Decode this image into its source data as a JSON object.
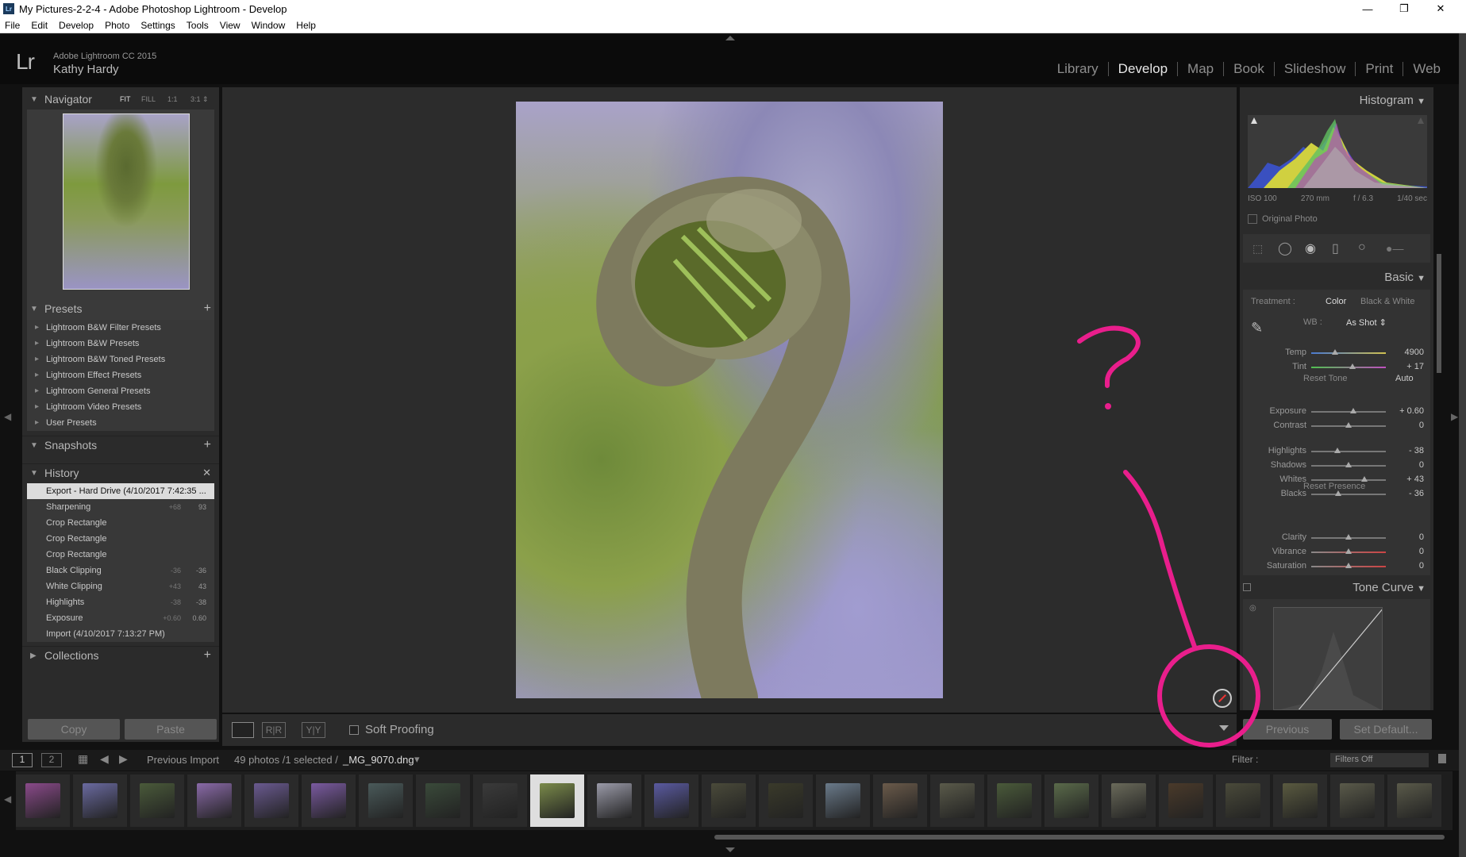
{
  "window": {
    "title": "My Pictures-2-2-4 - Adobe Photoshop Lightroom - Develop",
    "app_icon": "Lr",
    "minimize": "—",
    "maximize": "❐",
    "close": "✕"
  },
  "menu": [
    "File",
    "Edit",
    "Develop",
    "Photo",
    "Settings",
    "Tools",
    "View",
    "Window",
    "Help"
  ],
  "identity": {
    "logo": "Lr",
    "product": "Adobe Lightroom CC 2015",
    "user": "Kathy Hardy"
  },
  "modules": [
    {
      "label": "Library",
      "active": false
    },
    {
      "label": "Develop",
      "active": true
    },
    {
      "label": "Map",
      "active": false
    },
    {
      "label": "Book",
      "active": false
    },
    {
      "label": "Slideshow",
      "active": false
    },
    {
      "label": "Print",
      "active": false
    },
    {
      "label": "Web",
      "active": false
    }
  ],
  "navigator": {
    "title": "Navigator",
    "zoom_options": [
      "FIT",
      "FILL",
      "1:1",
      "3:1 ⇕"
    ]
  },
  "presets": {
    "title": "Presets",
    "add": "+",
    "items": [
      "Lightroom B&W Filter Presets",
      "Lightroom B&W Presets",
      "Lightroom B&W Toned Presets",
      "Lightroom Effect Presets",
      "Lightroom General Presets",
      "Lightroom Video Presets",
      "User Presets"
    ]
  },
  "snapshots": {
    "title": "Snapshots",
    "add": "+"
  },
  "history": {
    "title": "History",
    "clear": "✕",
    "items": [
      {
        "label": "Export - Hard Drive (4/10/2017 7:42:35 ...",
        "v1": "",
        "v2": "",
        "selected": true
      },
      {
        "label": "Sharpening",
        "v1": "+68",
        "v2": "93",
        "selected": false
      },
      {
        "label": "Crop Rectangle",
        "v1": "",
        "v2": "",
        "selected": false
      },
      {
        "label": "Crop Rectangle",
        "v1": "",
        "v2": "",
        "selected": false
      },
      {
        "label": "Crop Rectangle",
        "v1": "",
        "v2": "",
        "selected": false
      },
      {
        "label": "Black Clipping",
        "v1": "-36",
        "v2": "-36",
        "selected": false
      },
      {
        "label": "White Clipping",
        "v1": "+43",
        "v2": "43",
        "selected": false
      },
      {
        "label": "Highlights",
        "v1": "-38",
        "v2": "-38",
        "selected": false
      },
      {
        "label": "Exposure",
        "v1": "+0.60",
        "v2": "0.60",
        "selected": false
      },
      {
        "label": "Import (4/10/2017 7:13:27 PM)",
        "v1": "",
        "v2": "",
        "selected": false
      }
    ]
  },
  "collections": {
    "title": "Collections",
    "add": "+"
  },
  "left_buttons": {
    "copy": "Copy",
    "paste": "Paste"
  },
  "toolbar": {
    "soft_proofing": "Soft Proofing"
  },
  "histogram": {
    "title": "Histogram",
    "iso": "ISO 100",
    "focal": "270 mm",
    "aperture": "f / 6.3",
    "shutter": "1/40 sec",
    "original_photo": "Original Photo"
  },
  "basic": {
    "title": "Basic",
    "treatment_label": "Treatment :",
    "treatment_color": "Color",
    "treatment_bw": "Black & White",
    "wb_label": "WB :",
    "wb_value": "As Shot ⇕",
    "reset_tone": "Reset Tone",
    "auto": "Auto",
    "reset_presence": "Reset Presence",
    "sliders": [
      {
        "label": "Temp",
        "value": "4900",
        "pos": 0.32
      },
      {
        "label": "Tint",
        "value": "+ 17",
        "pos": 0.55
      },
      {
        "label": "Exposure",
        "value": "+ 0.60",
        "pos": 0.56
      },
      {
        "label": "Contrast",
        "value": "0",
        "pos": 0.5
      },
      {
        "label": "Highlights",
        "value": "- 38",
        "pos": 0.35
      },
      {
        "label": "Shadows",
        "value": "0",
        "pos": 0.5
      },
      {
        "label": "Whites",
        "value": "+ 43",
        "pos": 0.71
      },
      {
        "label": "Blacks",
        "value": "- 36",
        "pos": 0.36
      },
      {
        "label": "Clarity",
        "value": "0",
        "pos": 0.5
      },
      {
        "label": "Vibrance",
        "value": "0",
        "pos": 0.5
      },
      {
        "label": "Saturation",
        "value": "0",
        "pos": 0.5
      }
    ]
  },
  "tone_curve": {
    "title": "Tone Curve"
  },
  "right_buttons": {
    "previous": "Previous",
    "set_default": "Set Default..."
  },
  "filmstrip_bar": {
    "screen1": "1",
    "screen2": "2",
    "source": "Previous Import",
    "info": "49 photos /1 selected /",
    "filename": "_MG_9070.dng",
    "filter_label": "Filter :",
    "filter_value": "Filters Off"
  },
  "filmstrip": {
    "thumb_colors": [
      "#8a4a8a",
      "#6a6aa0",
      "#4a5a3a",
      "#8a6aa8",
      "#6a5a90",
      "#7a5aa0",
      "#4a5a5a",
      "#3a4a3a",
      "#3a3a3a",
      "#7a8a4a",
      "#9a9aa8",
      "#5a5aa0",
      "#4a4a3a",
      "#3a3a2a",
      "#6a7a8a",
      "#6a5a4a",
      "#5a5a4a",
      "#4a5a3a",
      "#5a6a4a",
      "#6a6a5a",
      "#4a3a2a",
      "#4a4a3a",
      "#5a5a40",
      "#5a5a4a",
      "#5a5a4a"
    ],
    "selected_index": 9
  },
  "annotation": {
    "question_mark": "?",
    "color": "#e91e8c"
  }
}
